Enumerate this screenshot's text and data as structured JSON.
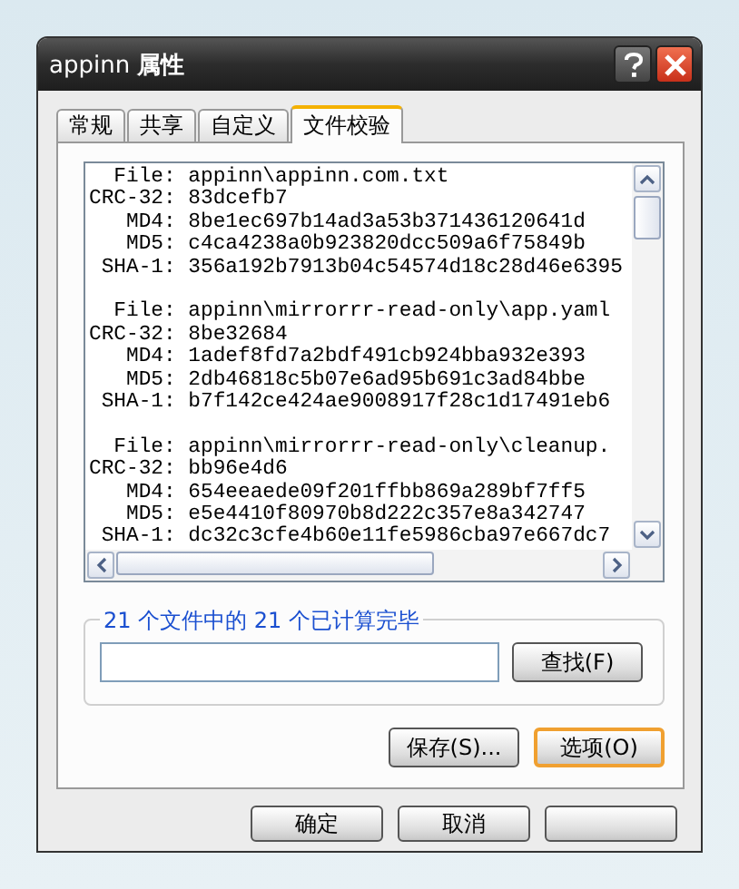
{
  "window": {
    "title_name": "appinn",
    "title_suffix": "属性"
  },
  "tabs": [
    {
      "label": "常规",
      "selected": false
    },
    {
      "label": "共享",
      "selected": false
    },
    {
      "label": "自定义",
      "selected": false
    },
    {
      "label": "文件校验",
      "selected": true
    }
  ],
  "results": [
    [
      {
        "label": "File:",
        "value": "appinn\\appinn.com.txt"
      },
      {
        "label": "CRC-32:",
        "value": "83dcefb7"
      },
      {
        "label": "MD4:",
        "value": "8be1ec697b14ad3a53b371436120641d"
      },
      {
        "label": "MD5:",
        "value": "c4ca4238a0b923820dcc509a6f75849b"
      },
      {
        "label": "SHA-1:",
        "value": "356a192b7913b04c54574d18c28d46e6395"
      }
    ],
    [
      {
        "label": "File:",
        "value": "appinn\\mirrorrr-read-only\\app.yaml"
      },
      {
        "label": "CRC-32:",
        "value": "8be32684"
      },
      {
        "label": "MD4:",
        "value": "1adef8fd7a2bdf491cb924bba932e393"
      },
      {
        "label": "MD5:",
        "value": "2db46818c5b07e6ad95b691c3ad84bbe"
      },
      {
        "label": "SHA-1:",
        "value": "b7f142ce424ae9008917f28c1d17491eb6"
      }
    ],
    [
      {
        "label": "File:",
        "value": "appinn\\mirrorrr-read-only\\cleanup."
      },
      {
        "label": "CRC-32:",
        "value": "bb96e4d6"
      },
      {
        "label": "MD4:",
        "value": "654eeaede09f201ffbb869a289bf7ff5"
      },
      {
        "label": "MD5:",
        "value": "e5e4410f80970b8d222c357e8a342747"
      },
      {
        "label": "SHA-1:",
        "value": "dc32c3cfe4b60e11fe5986cba97e667dc7"
      }
    ]
  ],
  "status_group": {
    "title": "21 个文件中的 21 个已计算完毕",
    "find_button": "查找(F)"
  },
  "action_buttons": [
    {
      "label": "保存(S)...",
      "default": false
    },
    {
      "label": "选项(O)",
      "default": true
    }
  ],
  "dialog_buttons": [
    {
      "label": "确定"
    },
    {
      "label": "取消"
    }
  ]
}
